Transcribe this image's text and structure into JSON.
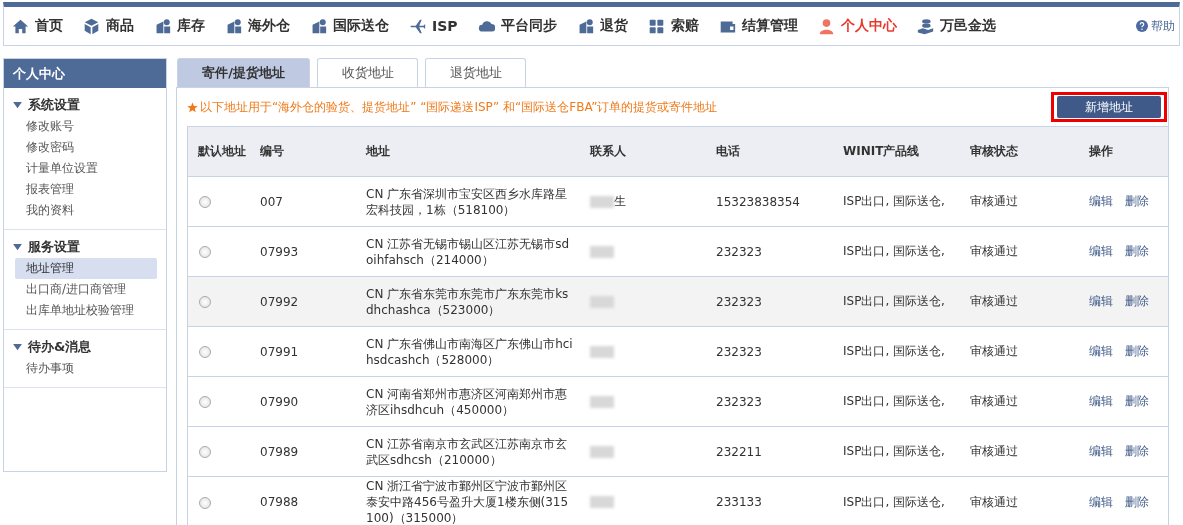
{
  "nav": {
    "items": [
      {
        "label": "首页",
        "selected": false
      },
      {
        "label": "商品",
        "selected": false
      },
      {
        "label": "库存",
        "selected": false
      },
      {
        "label": "海外仓",
        "selected": false
      },
      {
        "label": "国际送仓",
        "selected": false
      },
      {
        "label": "ISP",
        "selected": false
      },
      {
        "label": "平台同步",
        "selected": false
      },
      {
        "label": "退货",
        "selected": false
      },
      {
        "label": "索赔",
        "selected": false
      },
      {
        "label": "结算管理",
        "selected": false
      },
      {
        "label": "个人中心",
        "selected": true
      },
      {
        "label": "万邑金选",
        "selected": false
      }
    ],
    "help": "帮助"
  },
  "sidebar": {
    "title": "个人中心",
    "groups": [
      {
        "label": "系统设置",
        "expanded": true,
        "items": [
          {
            "label": "修改账号",
            "selected": false
          },
          {
            "label": "修改密码",
            "selected": false
          },
          {
            "label": "计量单位设置",
            "selected": false
          },
          {
            "label": "报表管理",
            "selected": false
          },
          {
            "label": "我的资料",
            "selected": false
          }
        ]
      },
      {
        "label": "服务设置",
        "expanded": true,
        "items": [
          {
            "label": "地址管理",
            "selected": true
          },
          {
            "label": "出口商/进口商管理",
            "selected": false
          },
          {
            "label": "出库单地址校验管理",
            "selected": false
          }
        ]
      },
      {
        "label": "待办&消息",
        "expanded": true,
        "items": [
          {
            "label": "待办事项",
            "selected": false
          }
        ]
      }
    ]
  },
  "tabs": [
    {
      "label": "寄件/提货地址",
      "selected": true
    },
    {
      "label": "收货地址",
      "selected": false
    },
    {
      "label": "退货地址",
      "selected": false
    }
  ],
  "notice": "以下地址用于“海外仓的验货、提货地址” “国际递送ISP” 和“国际送仓FBA”订单的提货或寄件地址",
  "add_button": "新增地址",
  "table": {
    "columns": [
      "默认地址",
      "编号",
      "地址",
      "联系人",
      "电话",
      "WINIT产品线",
      "审核状态",
      "操作"
    ],
    "rows": [
      {
        "selected": false,
        "highlighted": false,
        "number": "007",
        "address": "CN 广东省深圳市宝安区西乡水库路星宏科技园，1栋（518100）",
        "contact": "生",
        "phone": "15323838354",
        "product_line": "ISP出口, 国际送仓,",
        "status": "审核通过",
        "actions": [
          "编辑",
          "删除"
        ]
      },
      {
        "selected": false,
        "highlighted": false,
        "number": "07993",
        "address": "CN 江苏省无锡市锡山区江苏无锡市sdoihfahsch（214000）",
        "phone": "232323",
        "product_line": "ISP出口, 国际送仓,",
        "status": "审核通过",
        "actions": [
          "编辑",
          "删除"
        ]
      },
      {
        "selected": false,
        "highlighted": true,
        "number": "07992",
        "address": "CN 广东省东莞市东莞市广东东莞市ksdhchashca（523000）",
        "phone": "232323",
        "product_line": "ISP出口, 国际送仓,",
        "status": "审核通过",
        "actions": [
          "编辑",
          "删除"
        ]
      },
      {
        "selected": false,
        "highlighted": false,
        "number": "07991",
        "address": "CN 广东省佛山市南海区广东佛山市hcihsdcashch（528000）",
        "phone": "232323",
        "product_line": "ISP出口, 国际送仓,",
        "status": "审核通过",
        "actions": [
          "编辑",
          "删除"
        ]
      },
      {
        "selected": false,
        "highlighted": false,
        "number": "07990",
        "address": "CN 河南省郑州市惠济区河南郑州市惠济区ihsdhcuh（450000）",
        "phone": "232323",
        "product_line": "ISP出口, 国际送仓,",
        "status": "审核通过",
        "actions": [
          "编辑",
          "删除"
        ]
      },
      {
        "selected": false,
        "highlighted": false,
        "number": "07989",
        "address": "CN 江苏省南京市玄武区江苏南京市玄武区sdhcsh（210000）",
        "phone": "232211",
        "product_line": "ISP出口, 国际送仓,",
        "status": "审核通过",
        "actions": [
          "编辑",
          "删除"
        ]
      },
      {
        "selected": false,
        "highlighted": false,
        "number": "07988",
        "address": "CN 浙江省宁波市鄞州区宁波市鄞州区泰安中路456号盈升大厦1楼东侧(315100)（315000）",
        "phone": "233133",
        "product_line": "ISP出口, 国际送仓,",
        "status": "审核通过",
        "actions": [
          "编辑",
          "删除"
        ]
      }
    ]
  }
}
